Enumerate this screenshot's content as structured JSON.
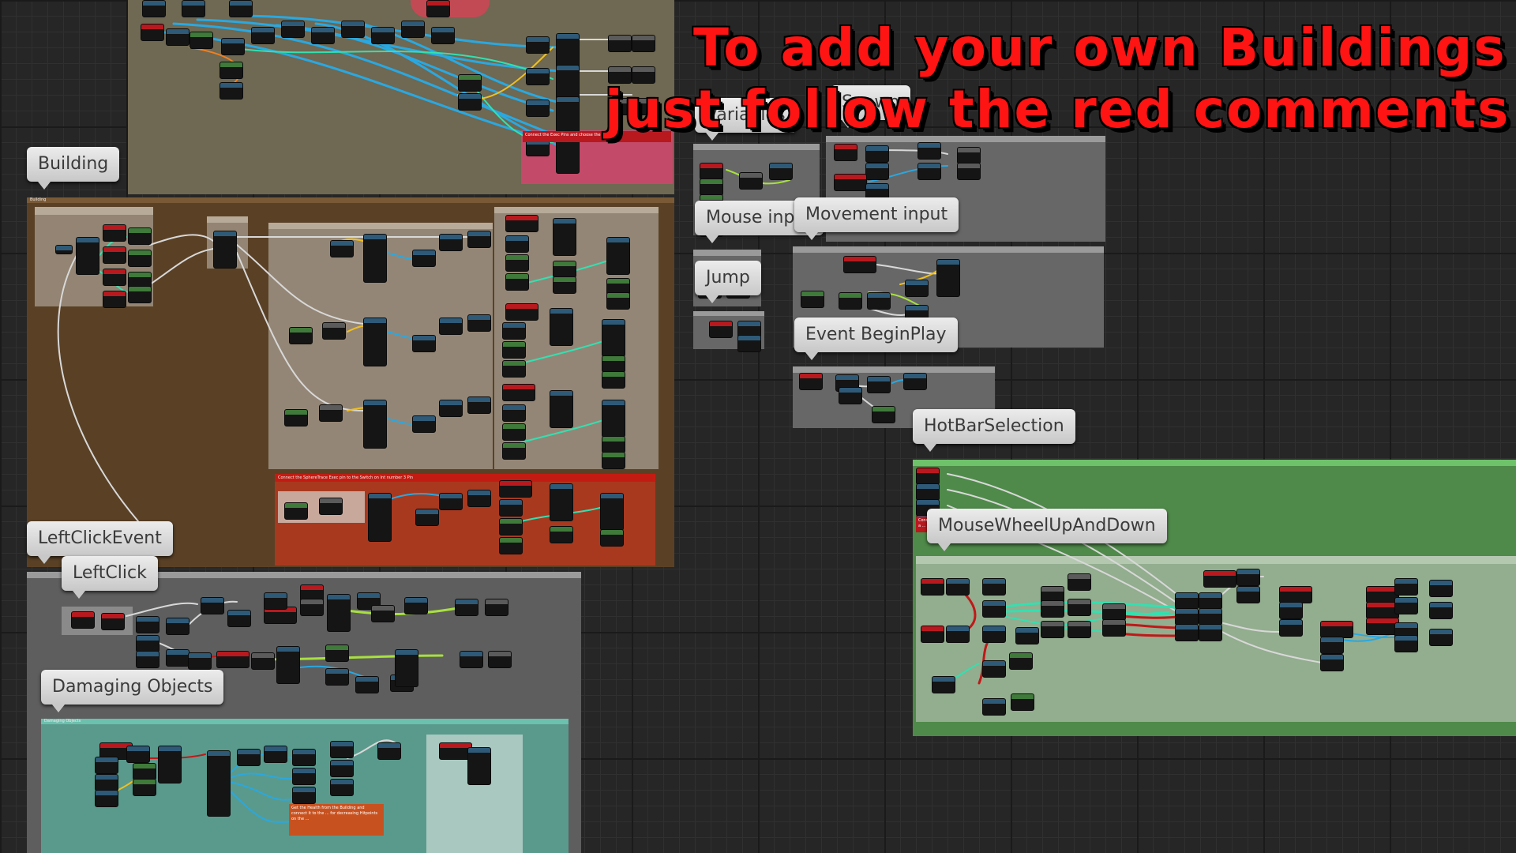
{
  "overlay": {
    "line1": "To add your own Buildings",
    "line2": "just follow the red comments"
  },
  "labels": {
    "building": "Building",
    "variables": "Variables",
    "spawn": "Spawn",
    "mouse_input": "Mouse input",
    "movement_input": "Movement input",
    "jump": "Jump",
    "event_begin_play": "Event BeginPlay",
    "hotbar_selection": "HotBarSelection",
    "mouse_wheel": "MouseWheelUpAndDown",
    "left_click_event": "LeftClickEvent",
    "left_click": "LeftClick",
    "damaging_objects": "Damaging Objects"
  },
  "small_text": {
    "building_header": "Building",
    "damaging_header": "Damaging Objects",
    "sphere_trace_comment": "Connect the SphereTrace Exec pin to the Switch on Int number 3 Pin",
    "top_pink_comment": "Connect the Exec Pins and choose the ...",
    "wheel_comment": "Connect the ... if you added a ...",
    "damage_comment": "Get the Health from the Building and connect it to the ... for decreasing Hitpoints on the ..."
  },
  "colors": {
    "accent_red": "#ff1414",
    "wire_blue": "#2aa8e0",
    "wire_cyan": "#33e0b0",
    "wire_yellow": "#f0c020",
    "wire_white": "#d8d8d8",
    "wire_red": "#c01818",
    "wire_green": "#a8e040"
  }
}
